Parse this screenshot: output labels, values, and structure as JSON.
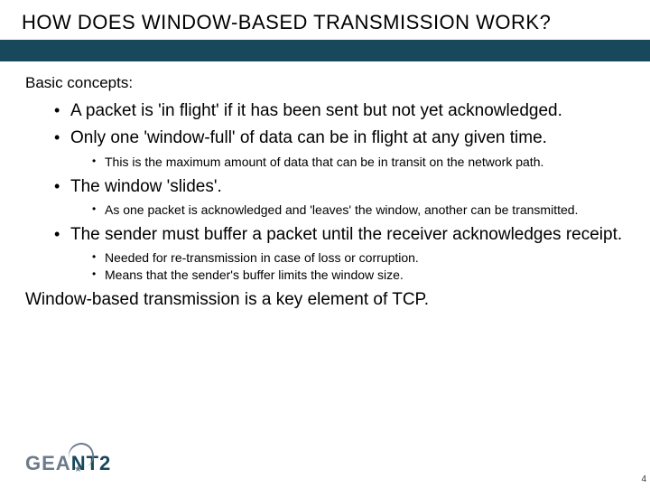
{
  "title": "HOW DOES WINDOW-BASED TRANSMISSION WORK?",
  "intro": "Basic concepts:",
  "bullets": [
    {
      "text": "A packet is 'in flight' if it has been sent but not yet acknowledged.",
      "sub": []
    },
    {
      "text": "Only one 'window-full' of data can be in flight at any given time.",
      "sub": [
        "This is the maximum amount of data that can be in transit on the network path."
      ]
    },
    {
      "text": "The window 'slides'.",
      "sub": [
        "As one packet is acknowledged and 'leaves' the window, another can be transmitted."
      ]
    },
    {
      "text": "The sender must buffer a packet until the receiver acknowledges receipt.",
      "sub": [
        "Needed for re-transmission in case of loss or corruption.",
        "Means that the sender's buffer limits the window size."
      ]
    }
  ],
  "conclusion": "Window-based transmission is a key element of TCP.",
  "logo": {
    "part1": "GE",
    "part2": "NT",
    "suffix": "2"
  },
  "page_number": "4"
}
